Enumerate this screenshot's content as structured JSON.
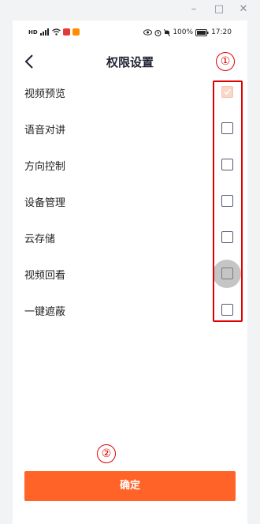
{
  "window": {
    "minimize_icon": "minimize-icon",
    "maximize_icon": "maximize-icon",
    "close_icon": "close-icon"
  },
  "statusbar": {
    "left_icons": [
      "hd-icon",
      "signal-icon",
      "wifi-icon",
      "app-icons"
    ],
    "battery": "100%",
    "time": "17:20"
  },
  "nav": {
    "title": "权限设置"
  },
  "permissions": [
    {
      "label": "视频预览",
      "checked": true
    },
    {
      "label": "语音对讲",
      "checked": false
    },
    {
      "label": "方向控制",
      "checked": false
    },
    {
      "label": "设备管理",
      "checked": false
    },
    {
      "label": "云存储",
      "checked": false
    },
    {
      "label": "视频回看",
      "checked": false
    },
    {
      "label": "一键遮蔽",
      "checked": false
    }
  ],
  "annotations": {
    "marker1": "①",
    "marker2": "②",
    "highlight_color": "#e00000"
  },
  "confirm_label": "确定",
  "colors": {
    "accent": "#ff6327",
    "checked_fill": "#f8d7c8"
  }
}
